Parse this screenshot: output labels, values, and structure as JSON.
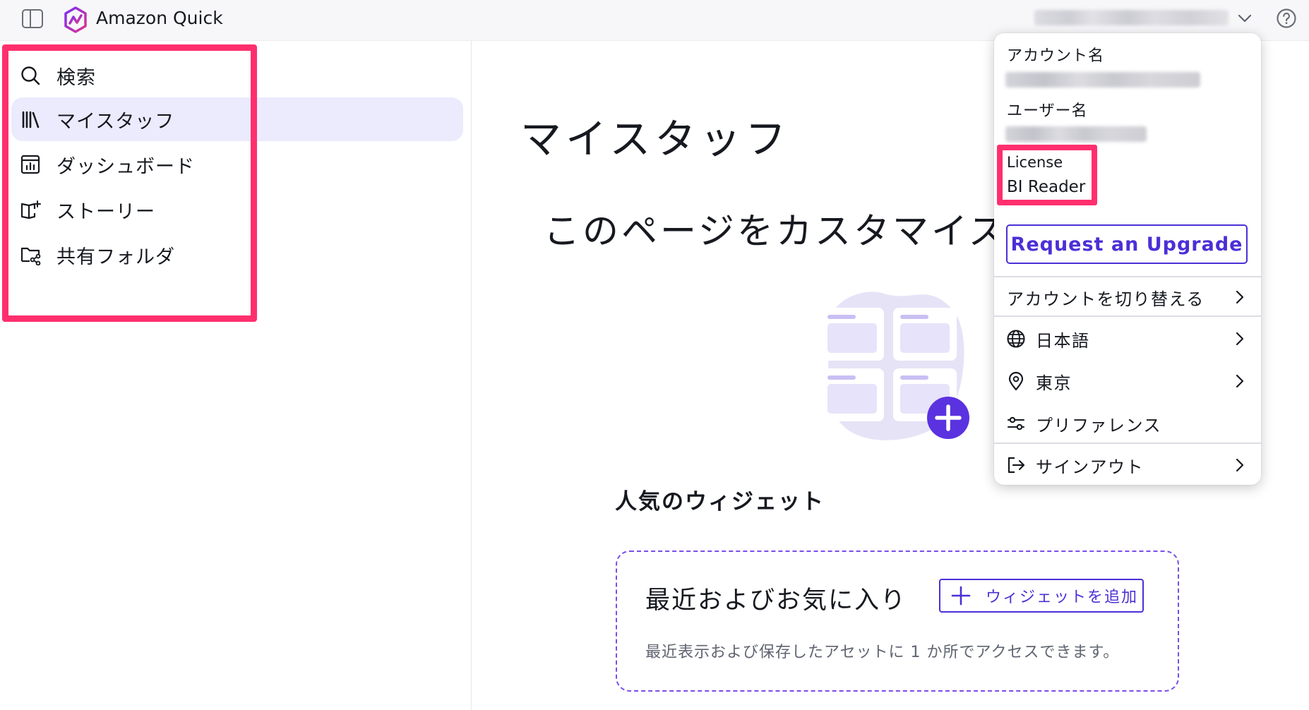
{
  "header": {
    "app_title": "Amazon Quick",
    "icons": [
      "sidebar-toggle-icon",
      "amazon-quick-logo",
      "chevron-down-icon",
      "help-icon"
    ]
  },
  "sidebar": {
    "items": [
      {
        "label": "検索",
        "icon": "search-icon",
        "active": false
      },
      {
        "label": "マイスタッフ",
        "icon": "library-icon",
        "active": true
      },
      {
        "label": "ダッシュボード",
        "icon": "dashboard-icon",
        "active": false
      },
      {
        "label": "ストーリー",
        "icon": "story-icon",
        "active": false
      },
      {
        "label": "共有フォルダ",
        "icon": "shared-folder-icon",
        "active": false
      }
    ]
  },
  "main": {
    "page_title": "マイスタッフ",
    "customize_title": "このページをカスタマイズ",
    "popular_widgets_title": "人気のウィジェット",
    "widget_card": {
      "title": "最近およびお気に入り",
      "add_button_label": "ウィジェットを追加",
      "description": "最近表示および保存したアセットに 1 か所でアクセスできます。"
    }
  },
  "account_menu": {
    "account_name_label": "アカウント名",
    "user_name_label": "ユーザー名",
    "license_label": "License",
    "license_value": "BI Reader",
    "upgrade_button": "Request an Upgrade",
    "switch_account": "アカウントを切り替える",
    "language": "日本語",
    "region": "東京",
    "preferences": "プリファレンス",
    "sign_out": "サインアウト"
  },
  "colors": {
    "accent": "#4c2fd6",
    "highlight": "#ff2f6e",
    "active_nav_bg": "#ebebfd",
    "widget_border": "#7a4de8"
  }
}
